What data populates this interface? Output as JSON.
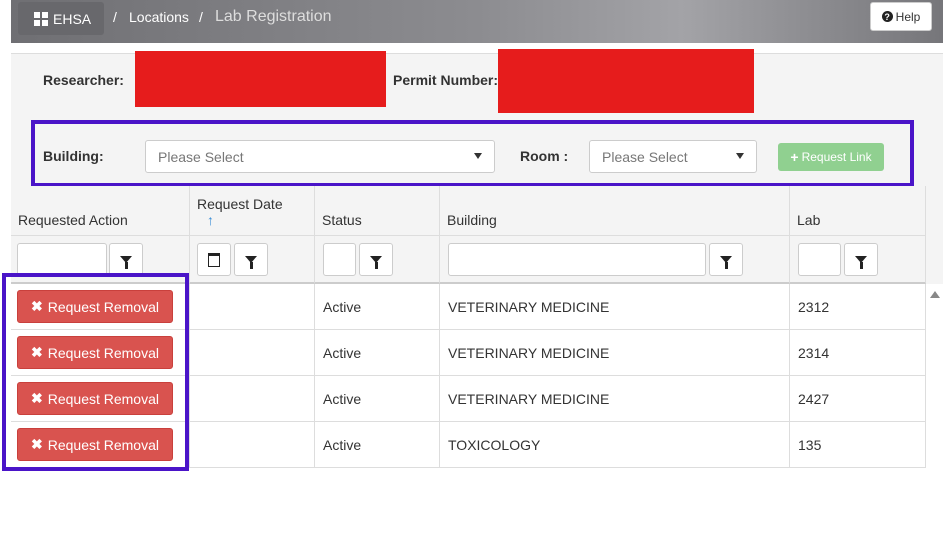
{
  "header": {
    "brand": "EHSA",
    "breadcrumb": [
      "Locations",
      "Lab Registration"
    ],
    "separator": "/",
    "help_label": "Help"
  },
  "info": {
    "researcher_label": "Researcher:",
    "permit_label": "Permit Number:"
  },
  "filter": {
    "building_label": "Building:",
    "building_placeholder": "Please Select",
    "room_label": "Room :",
    "room_placeholder": "Please Select",
    "request_link_label": "Request Link"
  },
  "grid": {
    "columns": [
      "Requested Action",
      "Request Date",
      "Status",
      "Building",
      "Lab"
    ],
    "sort_indicator": "↑",
    "rows": [
      {
        "action": "Request Removal",
        "date": "",
        "status": "Active",
        "building": "VETERINARY MEDICINE",
        "lab": "2312"
      },
      {
        "action": "Request Removal",
        "date": "",
        "status": "Active",
        "building": "VETERINARY MEDICINE",
        "lab": "2314"
      },
      {
        "action": "Request Removal",
        "date": "",
        "status": "Active",
        "building": "VETERINARY MEDICINE",
        "lab": "2427"
      },
      {
        "action": "Request Removal",
        "date": "",
        "status": "Active",
        "building": "TOXICOLOGY",
        "lab": "135"
      }
    ]
  },
  "colors": {
    "highlight": "#4a14c8",
    "redaction": "#e61c1c",
    "danger": "#d9534f",
    "success_disabled": "#90d090"
  }
}
